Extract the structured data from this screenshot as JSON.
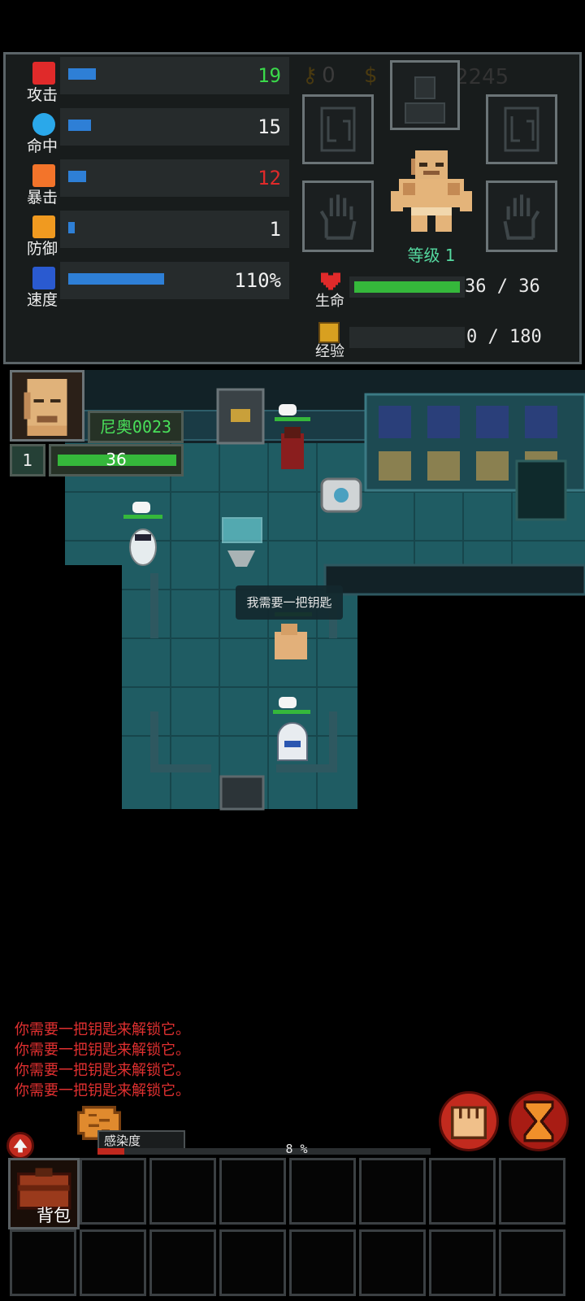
{
  "stats": [
    {
      "label": "攻击",
      "value": "19",
      "value_color": "#3ad94a",
      "fill": 0.12,
      "icon": "attack-sword-icon"
    },
    {
      "label": "命中",
      "value": "15",
      "value_color": "#f0f0f0",
      "fill": 0.1,
      "icon": "accuracy-crosshair-icon"
    },
    {
      "label": "暴击",
      "value": "12",
      "value_color": "#e02a2a",
      "fill": 0.08,
      "icon": "critical-burst-icon"
    },
    {
      "label": "防御",
      "value": "1",
      "value_color": "#f0f0f0",
      "fill": 0.03,
      "icon": "defense-shield-icon"
    },
    {
      "label": "速度",
      "value": "110%",
      "value_color": "#f0f0f0",
      "fill": 0.42,
      "icon": "speed-icon"
    }
  ],
  "currency": {
    "keys": "0",
    "money": "2245"
  },
  "character": {
    "level_label": "等级 1"
  },
  "vitals": {
    "hp_label": "生命",
    "hp_value": "36 / 36",
    "hp_fraction": 1.0,
    "xp_label": "经验",
    "xp_value": "0 / 180",
    "xp_fraction": 0.0
  },
  "player_hud": {
    "name": "尼奥0023",
    "level": "1",
    "hp": "36"
  },
  "dialog": {
    "text": "我需要一把钥匙"
  },
  "log": [
    "你需要一把钥匙来解锁它。",
    "你需要一把钥匙来解锁它。",
    "你需要一把钥匙来解锁它。",
    "你需要一把钥匙来解锁它。"
  ],
  "infection": {
    "label": "感染度",
    "value": "8 %"
  },
  "backpack": {
    "label": "背包"
  },
  "colors": {
    "accent_green": "#35b83b",
    "bar_blue": "#2e7fd6",
    "log_red": "#e03030"
  }
}
